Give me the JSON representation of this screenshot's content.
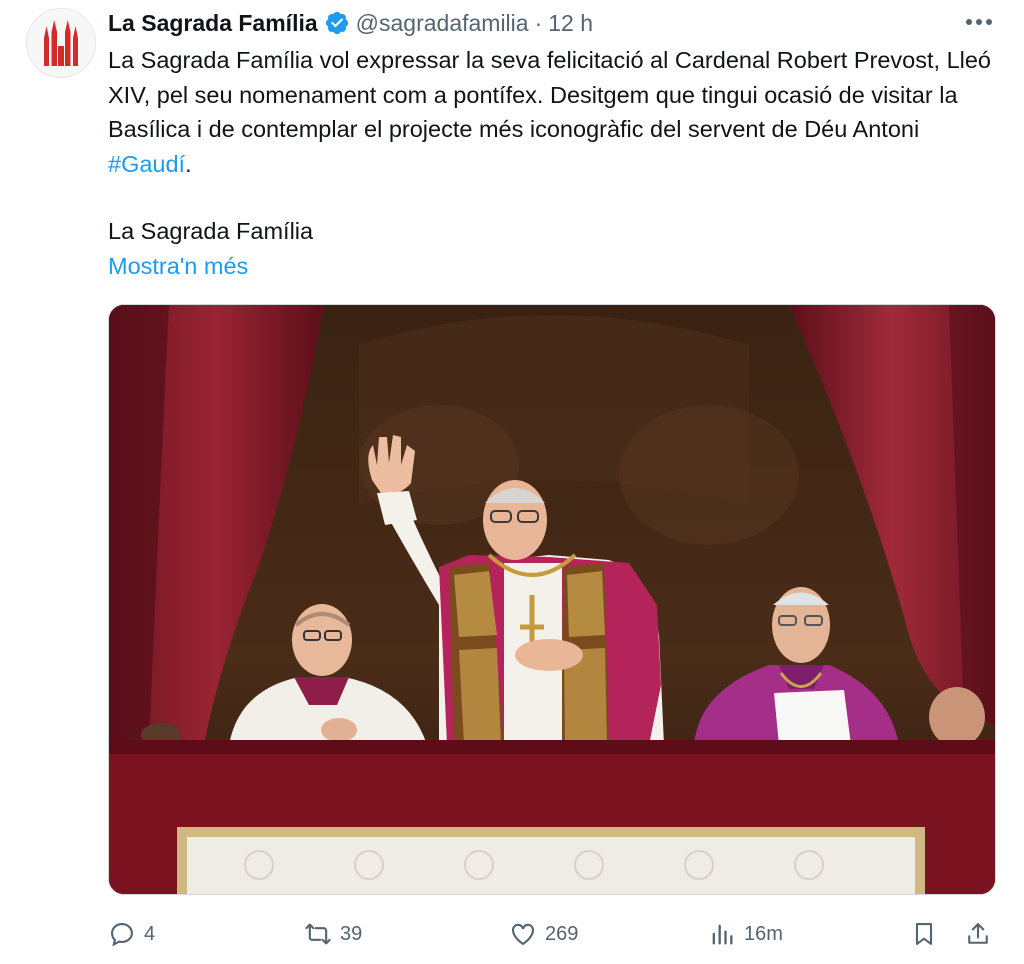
{
  "author": {
    "display_name": "La Sagrada Família",
    "handle": "@sagradafamilia",
    "separator": "·",
    "time": "12 h",
    "avatar_icon": "sagrada-familia-logo-icon",
    "verified_icon": "verified-badge-icon",
    "verified_color": "#1d9bf0"
  },
  "tweet": {
    "text_main": "La Sagrada Família vol expressar la seva felicitació al Cardenal Robert Prevost, Lleó XIV, pel seu nomenament com a pontífex. Desitgem que tingui ocasió de visitar la Basílica i de contemplar el projecte més iconogràfic del servent de Déu Antoni ",
    "hashtag": "#Gaudí",
    "text_end": ".",
    "signature": "La Sagrada Família",
    "show_more": "Mostra'n més",
    "link_color": "#1d9bf0"
  },
  "media": {
    "icon": "photo-pope-leo-xiv-balcony"
  },
  "actions": {
    "reply": {
      "icon": "reply-icon",
      "count": "4"
    },
    "repost": {
      "icon": "repost-icon",
      "count": "39"
    },
    "like": {
      "icon": "heart-icon",
      "count": "269"
    },
    "views": {
      "icon": "views-icon",
      "count": "16m"
    },
    "bookmark": {
      "icon": "bookmark-icon"
    },
    "share": {
      "icon": "share-icon"
    }
  }
}
